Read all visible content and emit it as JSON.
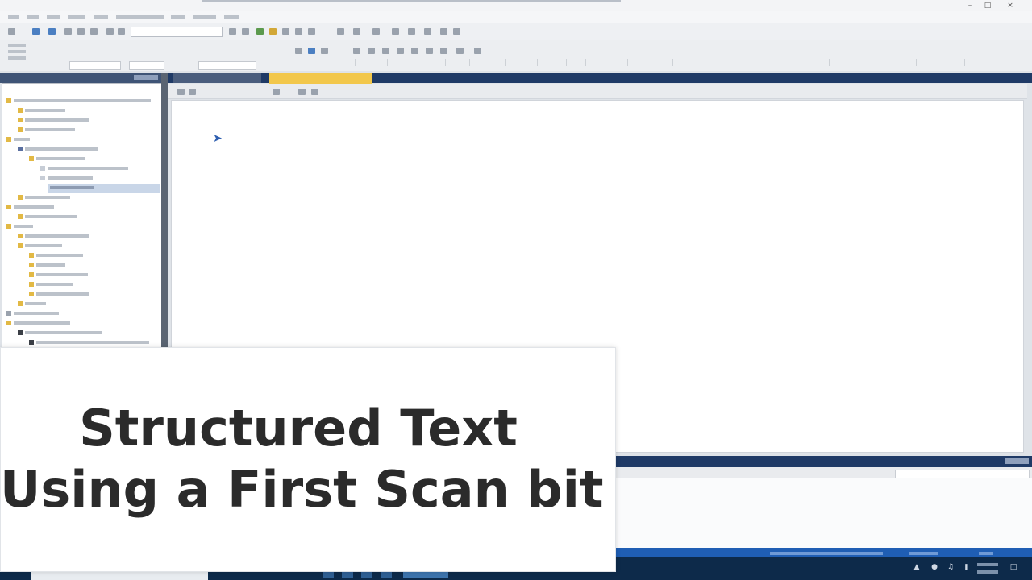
{
  "overlay": {
    "line1": "Structured Text",
    "line2": "Using a First Scan bit"
  },
  "icons": {
    "minimize": "minimize-icon",
    "maximize": "maximize-icon",
    "close": "close-icon",
    "cursor": "mouse-pointer-icon"
  },
  "colors": {
    "panel_header": "#1f3a66",
    "active_tab": "#f2c74b",
    "status_bar": "#1f5eb4",
    "taskbar": "#0d2a4a",
    "headline_text": "#2b2b2b"
  }
}
